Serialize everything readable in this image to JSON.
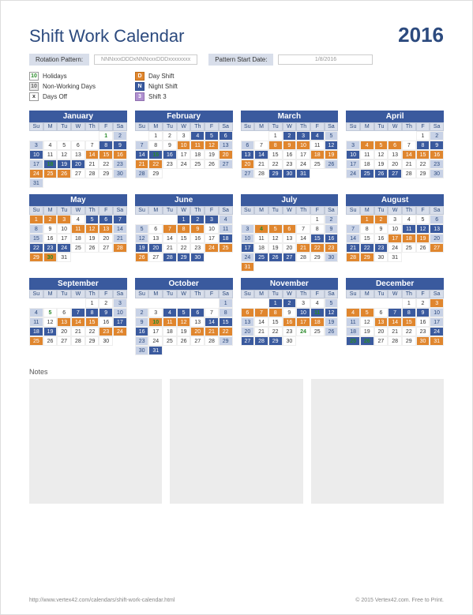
{
  "header": {
    "title": "Shift Work Calendar",
    "year": "2016"
  },
  "controls": {
    "pattern_label": "Rotation Pattern:",
    "pattern_value": "NNNxxxDDDxNNNxxxDDDxxxxxxxx",
    "start_label": "Pattern Start Date:",
    "start_value": "1/8/2016"
  },
  "legend": {
    "col1": [
      {
        "box": "10",
        "cls": "lg-hol",
        "text": "Holidays"
      },
      {
        "box": "10",
        "cls": "lg-nw",
        "text": "Non-Working Days"
      },
      {
        "box": "x",
        "cls": "lg-off",
        "text": "Days Off"
      }
    ],
    "col2": [
      {
        "box": "D",
        "cls": "lg-d",
        "text": "Day Shift"
      },
      {
        "box": "N",
        "cls": "lg-n",
        "text": "Night Shift"
      },
      {
        "box": "3",
        "cls": "lg-3",
        "text": "Shift 3"
      }
    ]
  },
  "dow": [
    "Su",
    "M",
    "Tu",
    "W",
    "Th",
    "F",
    "Sa"
  ],
  "months": [
    {
      "name": "January",
      "start": 5,
      "ndays": 31,
      "shifts": {
        "8": "n",
        "9": "n",
        "10": "n",
        "14": "d",
        "15": "d",
        "16": "d",
        "18": "n",
        "19": "n",
        "20": "n",
        "24": "d",
        "25": "d",
        "26": "d"
      },
      "hol": [
        1,
        18
      ]
    },
    {
      "name": "February",
      "start": 1,
      "ndays": 29,
      "shifts": {
        "4": "n",
        "5": "n",
        "6": "n",
        "10": "d",
        "11": "d",
        "12": "d",
        "14": "n",
        "15": "n",
        "16": "n",
        "20": "d",
        "21": "d",
        "22": "d"
      },
      "hol": [
        15
      ]
    },
    {
      "name": "March",
      "start": 2,
      "ndays": 31,
      "shifts": {
        "2": "n",
        "3": "n",
        "4": "n",
        "8": "d",
        "9": "d",
        "10": "d",
        "12": "n",
        "13": "n",
        "14": "n",
        "18": "d",
        "19": "d",
        "20": "d",
        "29": "n",
        "30": "n",
        "31": "n"
      },
      "hol": []
    },
    {
      "name": "April",
      "start": 5,
      "ndays": 30,
      "shifts": {
        "4": "d",
        "5": "d",
        "6": "d",
        "8": "n",
        "9": "n",
        "10": "n",
        "14": "d",
        "15": "d",
        "16": "d",
        "25": "n",
        "26": "n",
        "27": "n"
      },
      "hol": []
    },
    {
      "name": "May",
      "start": 0,
      "ndays": 31,
      "shifts": {
        "1": "d",
        "2": "d",
        "3": "d",
        "5": "n",
        "6": "n",
        "7": "n",
        "11": "d",
        "12": "d",
        "13": "d",
        "22": "n",
        "23": "n",
        "24": "n",
        "28": "d",
        "29": "d",
        "30": "d"
      },
      "hol": [
        30
      ]
    },
    {
      "name": "June",
      "start": 3,
      "ndays": 30,
      "shifts": {
        "1": "n",
        "2": "n",
        "3": "n",
        "7": "d",
        "8": "d",
        "9": "d",
        "18": "n",
        "19": "n",
        "20": "n",
        "24": "d",
        "25": "d",
        "26": "d",
        "28": "n",
        "29": "n",
        "30": "n"
      },
      "hol": []
    },
    {
      "name": "July",
      "start": 5,
      "ndays": 31,
      "shifts": {
        "4": "d",
        "5": "d",
        "6": "d",
        "15": "n",
        "16": "n",
        "17": "n",
        "21": "d",
        "22": "d",
        "23": "d",
        "25": "n",
        "26": "n",
        "27": "n",
        "31": "d"
      },
      "hol": [
        4
      ]
    },
    {
      "name": "August",
      "start": 1,
      "ndays": 31,
      "shifts": {
        "1": "d",
        "2": "d",
        "11": "n",
        "12": "n",
        "13": "n",
        "17": "d",
        "18": "d",
        "19": "d",
        "21": "n",
        "22": "n",
        "23": "n",
        "27": "d",
        "28": "d",
        "29": "d"
      },
      "hol": []
    },
    {
      "name": "September",
      "start": 4,
      "ndays": 30,
      "shifts": {
        "7": "n",
        "8": "n",
        "9": "n",
        "13": "d",
        "14": "d",
        "15": "d",
        "17": "n",
        "18": "n",
        "19": "n",
        "23": "d",
        "24": "d",
        "25": "d"
      },
      "hol": [
        5
      ]
    },
    {
      "name": "October",
      "start": 6,
      "ndays": 31,
      "shifts": {
        "4": "n",
        "5": "n",
        "6": "n",
        "10": "d",
        "11": "d",
        "12": "d",
        "14": "n",
        "15": "n",
        "16": "n",
        "20": "d",
        "21": "d",
        "22": "d",
        "31": "n"
      },
      "hol": [
        10
      ]
    },
    {
      "name": "November",
      "start": 2,
      "ndays": 30,
      "shifts": {
        "1": "n",
        "2": "n",
        "6": "d",
        "7": "d",
        "8": "d",
        "10": "n",
        "11": "n",
        "12": "n",
        "16": "d",
        "17": "d",
        "18": "d",
        "27": "n",
        "28": "n",
        "29": "n"
      },
      "hol": [
        11,
        24
      ]
    },
    {
      "name": "December",
      "start": 4,
      "ndays": 31,
      "shifts": {
        "3": "d",
        "4": "d",
        "5": "d",
        "7": "n",
        "8": "n",
        "9": "n",
        "13": "d",
        "14": "d",
        "15": "d",
        "24": "n",
        "25": "n",
        "26": "n",
        "30": "d",
        "31": "d"
      },
      "hol": [
        25,
        26
      ]
    }
  ],
  "notes_label": "Notes",
  "footer": {
    "url": "http://www.vertex42.com/calendars/shift-work-calendar.html",
    "copy": "© 2015 Vertex42.com. Free to Print."
  }
}
